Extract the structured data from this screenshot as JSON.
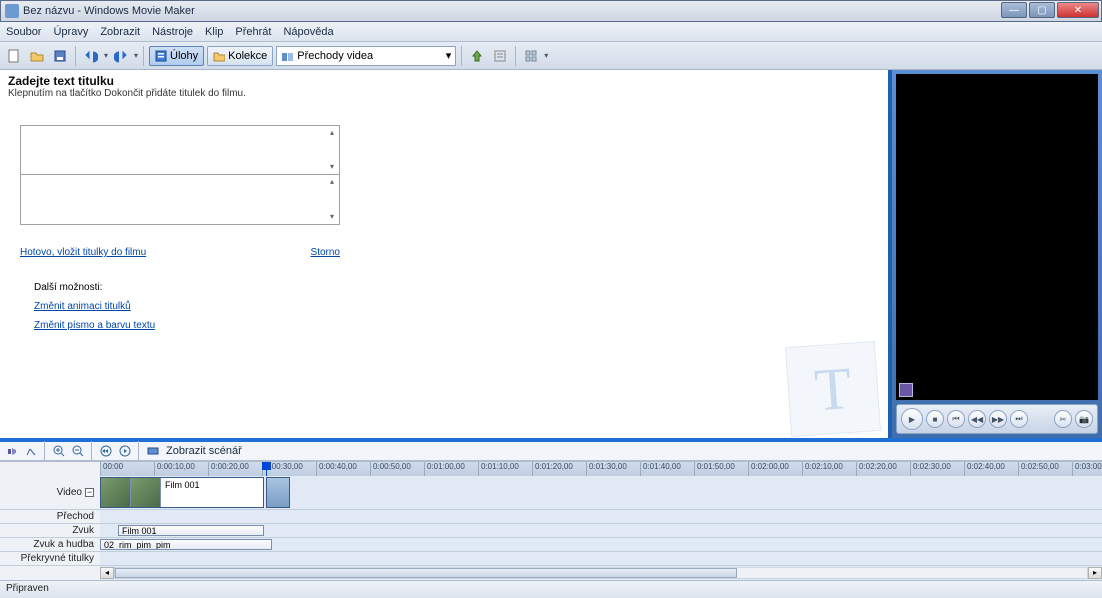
{
  "window": {
    "title": "Bez názvu - Windows Movie Maker"
  },
  "menu": {
    "items": [
      "Soubor",
      "Úpravy",
      "Zobrazit",
      "Nástroje",
      "Klip",
      "Přehrát",
      "Nápověda"
    ]
  },
  "toolbar": {
    "tasks_label": "Úlohy",
    "collections_label": "Kolekce",
    "combo_value": "Přechody videa"
  },
  "title_editor": {
    "heading": "Zadejte text titulku",
    "subheading": "Klepnutím na tlačítko Dokončit přidáte titulek do filmu.",
    "done_link": "Hotovo, vložit titulky do filmu",
    "cancel_link": "Storno",
    "more_heading": "Další možnosti:",
    "change_anim": "Změnit animaci titulků",
    "change_font": "Změnit písmo a barvu textu"
  },
  "timeline_toolbar": {
    "switch_label": "Zobrazit scénář"
  },
  "ruler": {
    "marks": [
      "00:00",
      "0:00:10,00",
      "0:00:20,00",
      "0:00:30,00",
      "0:00:40,00",
      "0:00:50,00",
      "0:01:00,00",
      "0:01:10,00",
      "0:01:20,00",
      "0:01:30,00",
      "0:01:40,00",
      "0:01:50,00",
      "0:02:00,00",
      "0:02:10,00",
      "0:02:20,00",
      "0:02:30,00",
      "0:02:40,00",
      "0:02:50,00",
      "0:03:00"
    ]
  },
  "tracks": {
    "video": "Video",
    "transition": "Přechod",
    "audio": "Zvuk",
    "audio_music": "Zvuk a hudba",
    "overlay": "Překryvné titulky"
  },
  "clips": {
    "video1": "Film 001",
    "audio1": "Film 001",
    "music1": "02_rim_pim_pim"
  },
  "status": {
    "text": "Připraven"
  }
}
